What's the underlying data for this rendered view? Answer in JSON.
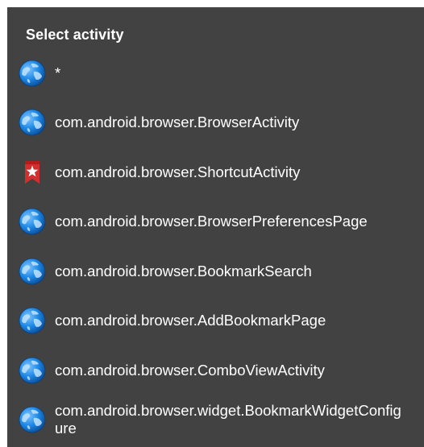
{
  "dialog": {
    "title": "Select activity"
  },
  "items": [
    {
      "label": "*",
      "icon": "globe-icon"
    },
    {
      "label": "com.android.browser.BrowserActivity",
      "icon": "globe-icon"
    },
    {
      "label": "com.android.browser.ShortcutActivity",
      "icon": "bookmark-star-icon"
    },
    {
      "label": "com.android.browser.BrowserPreferencesPage",
      "icon": "globe-icon"
    },
    {
      "label": "com.android.browser.BookmarkSearch",
      "icon": "globe-icon"
    },
    {
      "label": "com.android.browser.AddBookmarkPage",
      "icon": "globe-icon"
    },
    {
      "label": "com.android.browser.ComboViewActivity",
      "icon": "globe-icon"
    },
    {
      "label": "com.android.browser.widget.BookmarkWidgetConfigure",
      "icon": "globe-icon"
    }
  ],
  "colors": {
    "dialog_bg": "#424242",
    "text": "#ffffff",
    "globe_blue": "#1e88e5",
    "bookmark_red": "#d32f2f"
  }
}
